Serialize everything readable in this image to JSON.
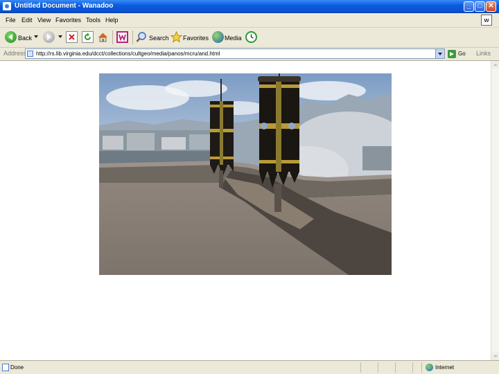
{
  "window": {
    "title": "Untitled Document - Wanadoo",
    "controls": {
      "minimize": "_",
      "maximize": "□",
      "close": "✕"
    }
  },
  "menu": {
    "items": [
      "File",
      "Edit",
      "View",
      "Favorites",
      "Tools",
      "Help"
    ]
  },
  "toolbar": {
    "back_label": "Back",
    "search_label": "Search",
    "favorites_label": "Favorites",
    "media_label": "Media"
  },
  "address": {
    "label": "Address",
    "url": "http://rs.lib.virginia.edu/dcct/collections/cultgeo/media/panos/mcru/and.html",
    "go_label": "Go",
    "links_label": "Links"
  },
  "status": {
    "text": "Done",
    "zone": "Internet"
  },
  "colors": {
    "titlebar": "#0a5ce0",
    "chrome": "#ece9d8"
  },
  "icons": [
    "back-icon",
    "forward-icon",
    "stop-icon",
    "refresh-icon",
    "home-icon",
    "wanadoo-icon",
    "search-icon",
    "favorites-icon",
    "media-icon",
    "history-icon",
    "go-icon",
    "internet-zone-icon"
  ]
}
